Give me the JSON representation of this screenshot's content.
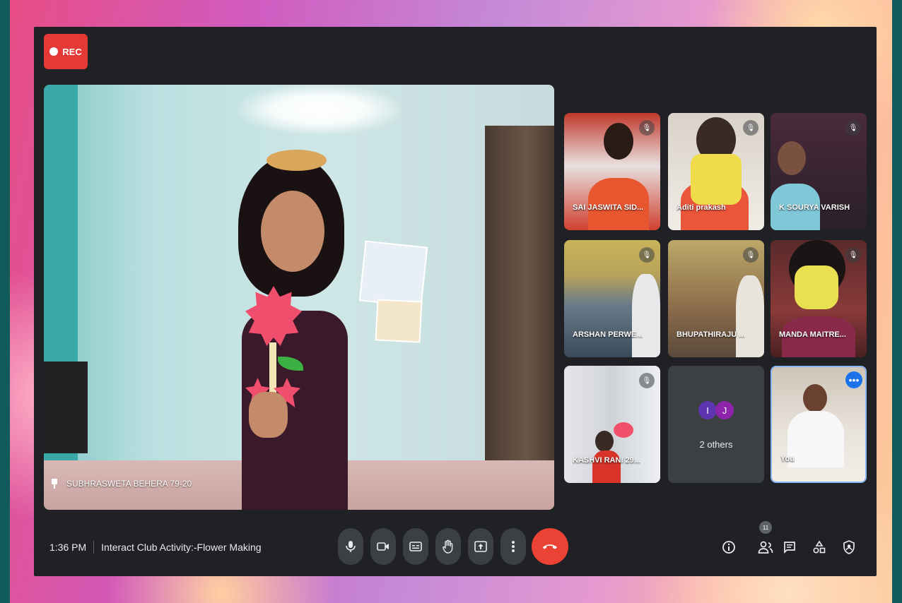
{
  "recording": {
    "label": "REC"
  },
  "main_participant": {
    "name": "SUBHRASWETA BEHERA 79-20"
  },
  "participants": [
    {
      "name": "SAI JASWITA SID..."
    },
    {
      "name": "Aditi prakash"
    },
    {
      "name": "K SOURYA VARISH"
    },
    {
      "name": "ARSHAN PERWE..."
    },
    {
      "name": "BHUPATHIRAJU ..."
    },
    {
      "name": "MANDA MAITRE..."
    },
    {
      "name": "KASHVI RANI 29..."
    }
  ],
  "others": {
    "avatars": [
      "I",
      "J"
    ],
    "label": "2 others",
    "colors": [
      "#5e35b1",
      "#8e24aa"
    ]
  },
  "self_tile": {
    "name": "You"
  },
  "footer": {
    "time": "1:36 PM",
    "meeting_title": "Interact Club Activity:-Flower Making",
    "people_count": "11"
  },
  "icons": {
    "mic": "microphone-icon",
    "camera": "camera-icon",
    "captions": "captions-icon",
    "hand": "raise-hand-icon",
    "present": "present-icon",
    "more": "more-vert-icon",
    "end": "end-call-icon",
    "info": "info-icon",
    "people": "people-icon",
    "chat": "chat-icon",
    "activities": "activities-icon",
    "host": "host-controls-icon"
  },
  "colors": {
    "end_call": "#ea4335",
    "rec": "#e53935",
    "window": "#202124",
    "self_border": "#8ab4f8"
  }
}
